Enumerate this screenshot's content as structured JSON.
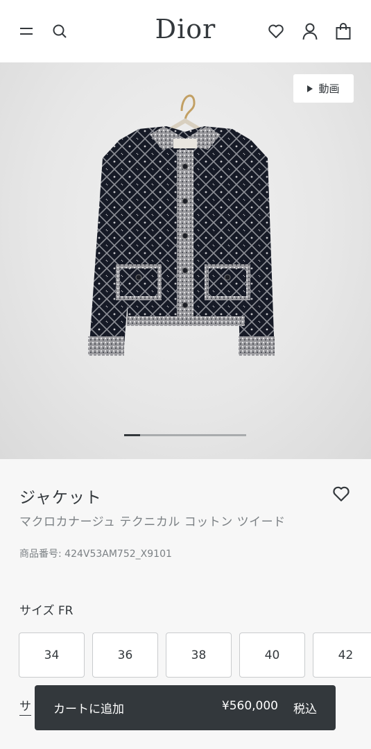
{
  "header": {
    "logo": "Dior",
    "icons": [
      "menu-icon",
      "search-icon",
      "heart-icon",
      "account-icon",
      "bag-icon"
    ]
  },
  "hero": {
    "video_label": "動画",
    "carousel_progress": 0.13
  },
  "product": {
    "title": "ジャケット",
    "subtitle": "マクロカナージュ テクニカル コットン ツイード",
    "reference": "商品番号: 424V53AM752_X9101"
  },
  "sizes": {
    "label": "サイズ FR",
    "options": [
      "34",
      "36",
      "38",
      "40",
      "42"
    ]
  },
  "size_guide": "サ",
  "cart": {
    "label": "カートに追加",
    "price": "¥560,000",
    "tax": "税込"
  },
  "colors": {
    "text": "#33383c",
    "muted": "#7b8084",
    "background": "#f7f7f7",
    "cart_bar": "#33383c"
  }
}
